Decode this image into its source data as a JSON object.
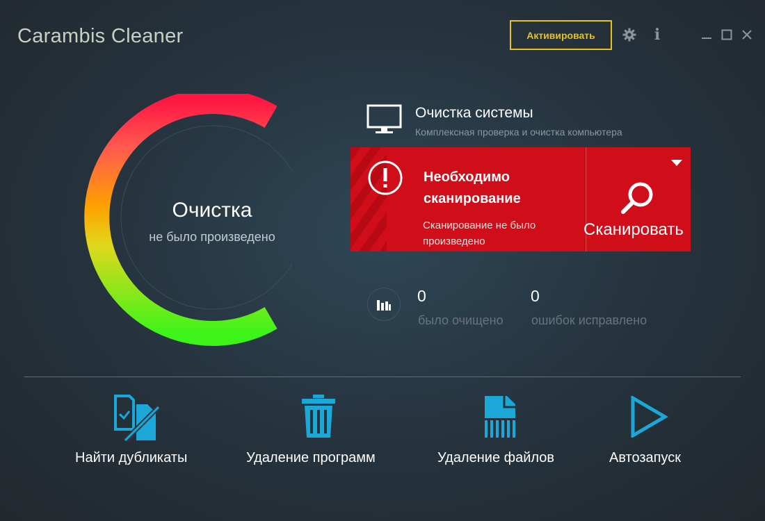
{
  "header": {
    "app_title": "Carambis Cleaner",
    "activate_label": "Активировать",
    "info_glyph": "i"
  },
  "gauge": {
    "title": "Очистка",
    "subtitle": "не было произведено",
    "colors": [
      "#ff1744",
      "#ff9800",
      "#ffeb3b",
      "#3df41a"
    ]
  },
  "system": {
    "title": "Очистка системы",
    "subtitle": "Комплексная проверка и очистка компьютера"
  },
  "alert": {
    "title_line1": "Необходимо",
    "title_line2": "сканирование",
    "desc_line1": "Сканирование не было",
    "desc_line2": "произведено",
    "color": "#cf0e1a"
  },
  "scan": {
    "label": "Сканировать"
  },
  "stats": {
    "cleaned_value": "0",
    "cleaned_label": "было очищено",
    "fixed_value": "0",
    "fixed_label": "ошибок исправлено"
  },
  "tools": [
    {
      "label": "Найти дубликаты",
      "icon": "duplicate-files-icon"
    },
    {
      "label": "Удаление программ",
      "icon": "trash-icon"
    },
    {
      "label": "Удаление файлов",
      "icon": "shredder-file-icon"
    },
    {
      "label": "Автозапуск",
      "icon": "play-icon"
    }
  ],
  "accent_color": "#1ba8d8"
}
